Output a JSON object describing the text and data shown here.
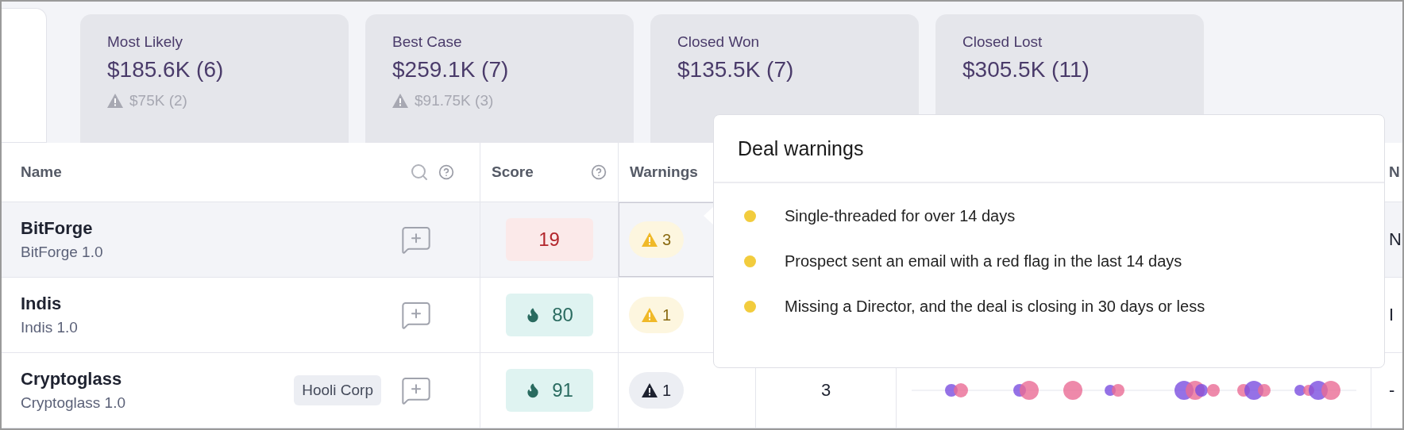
{
  "summary_cards": [
    {
      "title": "Most Likely",
      "value": "$185.6K (6)",
      "warning": "$75K (2)"
    },
    {
      "title": "Best Case",
      "value": "$259.1K (7)",
      "warning": "$91.75K (3)"
    },
    {
      "title": "Closed Won",
      "value": "$135.5K (7)"
    },
    {
      "title": "Closed Lost",
      "value": "$305.5K (11)"
    }
  ],
  "table": {
    "columns": [
      {
        "label": "Name",
        "search": true,
        "help": true
      },
      {
        "label": "Score",
        "search": false,
        "help": true
      },
      {
        "label": "Warnings"
      },
      {
        "label": "N"
      }
    ],
    "rows": [
      {
        "name": "BitForge",
        "version": "BitForge 1.0",
        "score": "19",
        "hot": false,
        "warnings": "3",
        "warning_highlight": true,
        "selected": true,
        "has_activity": false,
        "last_column": "N"
      },
      {
        "name": "Indis",
        "version": "Indis 1.0",
        "score": "80",
        "hot": true,
        "warnings": "1",
        "warning_highlight": true,
        "selected": false,
        "has_activity": false,
        "last_column": "I"
      },
      {
        "name": "Cryptoglass",
        "version": "Cryptoglass 1.0",
        "tag": "Hooli Corp",
        "score": "91",
        "hot": true,
        "warnings": "1",
        "warning_highlight": false,
        "selected": false,
        "column_4": "3",
        "has_activity": true,
        "last_column": "-"
      }
    ]
  },
  "popover": {
    "title": "Deal warnings",
    "items": [
      {
        "text": "Single-threaded for over 14 days"
      },
      {
        "text": "Prospect sent an email with a red flag in the last 14 days"
      },
      {
        "text": "Missing a Director, and the deal is closing in 30 days or less"
      }
    ]
  }
}
